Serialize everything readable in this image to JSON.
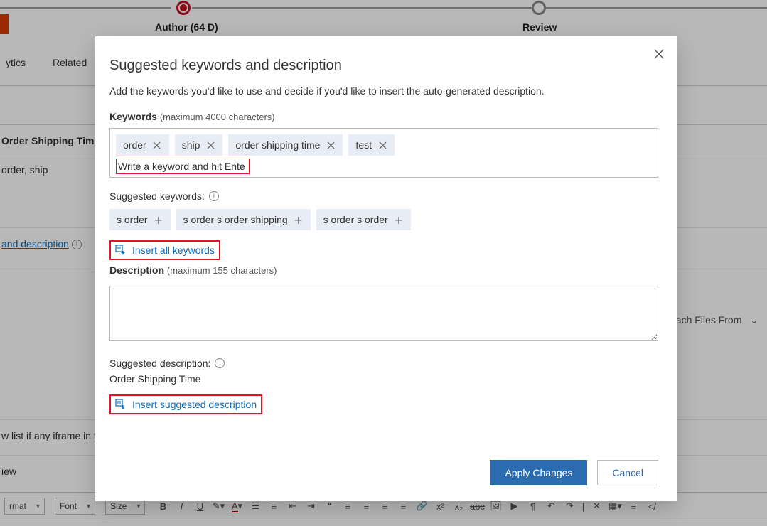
{
  "stepper": {
    "author": "Author  (64 D)",
    "review": "Review"
  },
  "tabs": {
    "analytics": "ytics",
    "related": "Related"
  },
  "bg": {
    "row1": "Order Shipping Time",
    "row2": "order, ship",
    "link": "and description",
    "attach": "ach Files From",
    "row5": "w list if any iframe in t",
    "row6": "iew"
  },
  "tb": {
    "format": "rmat",
    "font": "Font",
    "size": "Size"
  },
  "modal": {
    "title": "Suggested keywords and description",
    "subtitle": "Add the keywords you'd like to use and decide if you'd like to insert the auto-generated description.",
    "kw_label": "Keywords",
    "kw_hint": "(maximum 4000 characters)",
    "chips": [
      "order",
      "ship",
      "order shipping time",
      "test"
    ],
    "kw_placeholder": "Write a keyword and hit Enter",
    "sugg_label": "Suggested keywords:",
    "sugg": [
      "s order",
      "s order s order shipping",
      "s order s order"
    ],
    "insert_kw": "Insert all keywords",
    "desc_label": "Description",
    "desc_hint": "(maximum 155 characters)",
    "sugg_desc_label": "Suggested description:",
    "sugg_desc": "Order Shipping Time",
    "insert_desc": "Insert suggested description",
    "apply": "Apply Changes",
    "cancel": "Cancel"
  }
}
